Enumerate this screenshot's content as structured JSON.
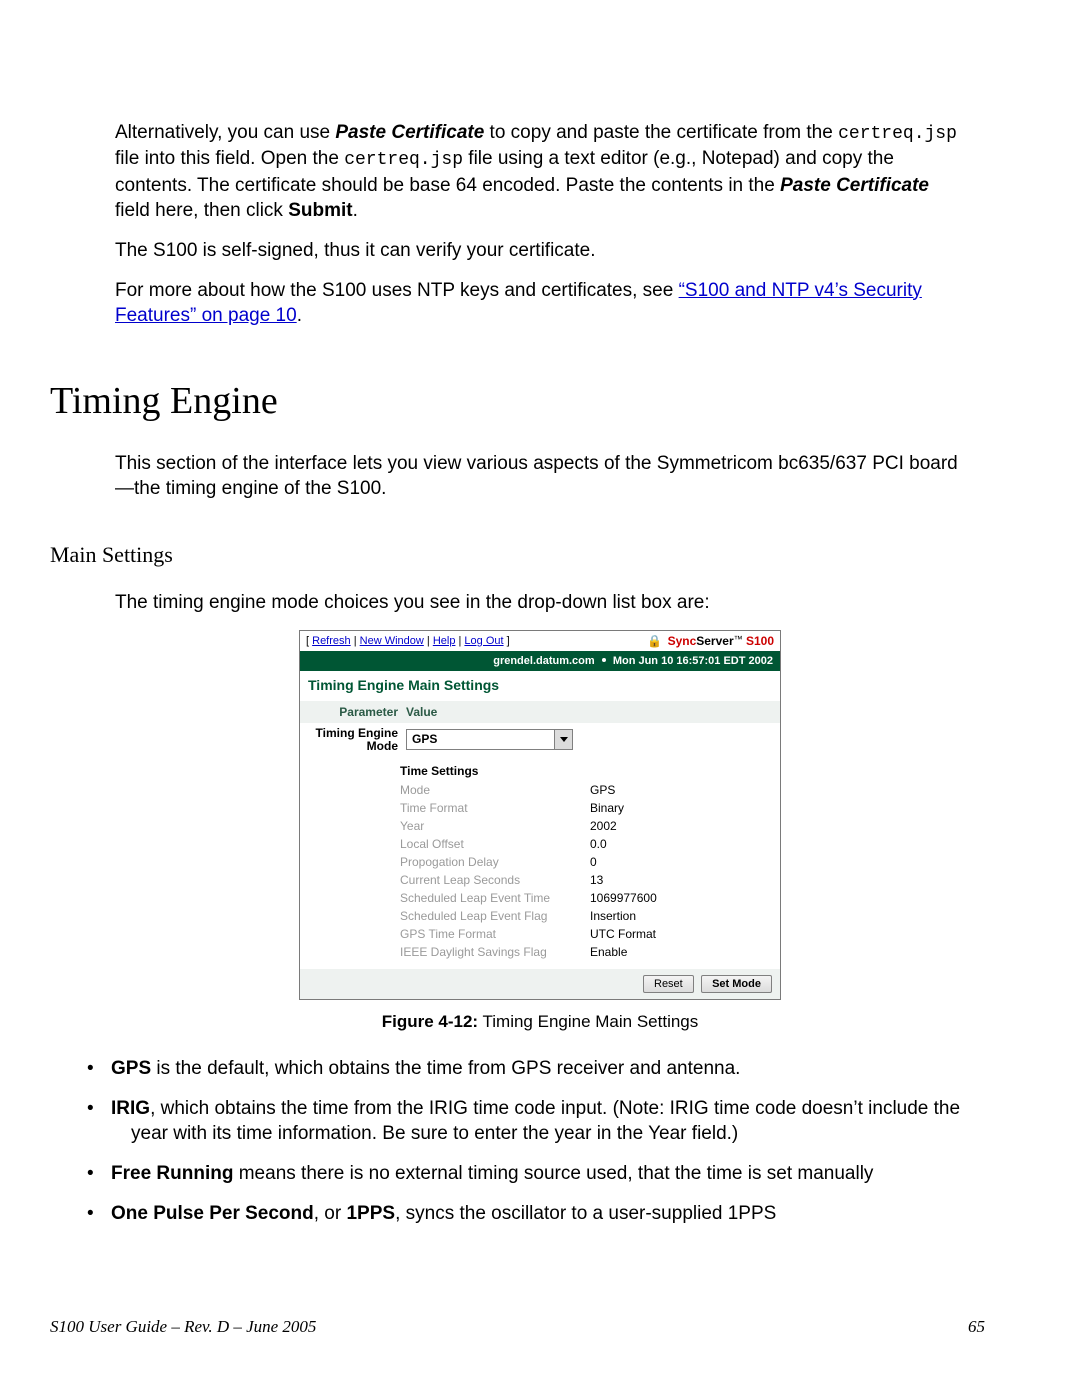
{
  "intro": {
    "para1_parts": [
      {
        "t": "Alternatively, you can use ",
        "cls": ""
      },
      {
        "t": "Paste Certificate",
        "cls": "bold-italic"
      },
      {
        "t": " to copy and paste the certificate from the ",
        "cls": ""
      },
      {
        "t": "certreq.jsp",
        "cls": "mono"
      },
      {
        "t": " file into this field. Open the ",
        "cls": ""
      },
      {
        "t": "certreq.jsp",
        "cls": "mono"
      },
      {
        "t": " file using a text editor (e.g., Notepad) and copy the contents. The certificate should be base 64 encoded. Paste the contents in the ",
        "cls": ""
      },
      {
        "t": "Paste Certificate",
        "cls": "bold-italic"
      },
      {
        "t": " field here, then click ",
        "cls": ""
      },
      {
        "t": "Submit",
        "cls": "bold"
      },
      {
        "t": ".",
        "cls": ""
      }
    ],
    "para2": "The S100 is self-signed, thus it can verify your certificate.",
    "para3_parts": [
      {
        "t": "For more about how the S100 uses NTP keys and certificates, see ",
        "cls": ""
      },
      {
        "t": "“S100 and NTP v4’s Security Features” on page 10",
        "cls": "link"
      },
      {
        "t": ".",
        "cls": ""
      }
    ]
  },
  "section_title": "Timing Engine",
  "section_intro": "This section of the interface lets you view various aspects of the Symmetricom bc635/637 PCI board—the timing engine of the S100.",
  "subsection_title": "Main Settings",
  "subsection_intro": "The timing engine mode choices you see in the drop-down list box are:",
  "screenshot": {
    "top_links": [
      "Refresh",
      "New Window",
      "Help",
      "Log Out"
    ],
    "logo": {
      "sync": "Sync",
      "server": "Server",
      "tm": "™",
      "model": "S100"
    },
    "status_bar": {
      "host": "grendel.datum.com",
      "time": "Mon Jun 10 16:57:01 EDT 2002"
    },
    "page_title": "Timing Engine Main Settings",
    "header": {
      "param_label": "Parameter",
      "value_label": "Value"
    },
    "engine_row": {
      "label": "Timing Engine Mode",
      "selected": "GPS"
    },
    "time_settings_heading": "Time Settings",
    "time_settings": [
      {
        "k": "Mode",
        "v": "GPS"
      },
      {
        "k": "Time Format",
        "v": "Binary"
      },
      {
        "k": "Year",
        "v": "2002"
      },
      {
        "k": "Local Offset",
        "v": "0.0"
      },
      {
        "k": "Propogation Delay",
        "v": "0"
      },
      {
        "k": "Current Leap Seconds",
        "v": "13"
      },
      {
        "k": "Scheduled Leap Event Time",
        "v": "1069977600"
      },
      {
        "k": "Scheduled Leap Event Flag",
        "v": "Insertion"
      },
      {
        "k": "GPS Time Format",
        "v": "UTC Format"
      },
      {
        "k": "IEEE Daylight Savings Flag",
        "v": "Enable"
      }
    ],
    "buttons": {
      "reset": "Reset",
      "set_mode": "Set Mode"
    }
  },
  "figure_caption": {
    "label": "Figure 4-12:",
    "text": "Timing Engine Main Settings"
  },
  "bullets": [
    [
      {
        "t": "GPS",
        "cls": "bold"
      },
      {
        "t": " is the default, which obtains the time from GPS receiver and antenna.",
        "cls": ""
      }
    ],
    [
      {
        "t": "IRIG",
        "cls": "bold"
      },
      {
        "t": ", which obtains the time from the IRIG time code input. (Note: IRIG time code doesn’t include the year with its time information. Be sure to enter the year in the Year field.)",
        "cls": ""
      }
    ],
    [
      {
        "t": "Free Running",
        "cls": "bold"
      },
      {
        "t": " means there is no external timing source used, that the time is set manually",
        "cls": ""
      }
    ],
    [
      {
        "t": "One Pulse Per Second",
        "cls": "bold"
      },
      {
        "t": ", or ",
        "cls": ""
      },
      {
        "t": "1PPS",
        "cls": "bold"
      },
      {
        "t": ", syncs the oscillator to a user-supplied 1PPS",
        "cls": ""
      }
    ]
  ],
  "footer": {
    "left": "S100 User Guide – Rev. D – June 2005",
    "right": "65"
  }
}
